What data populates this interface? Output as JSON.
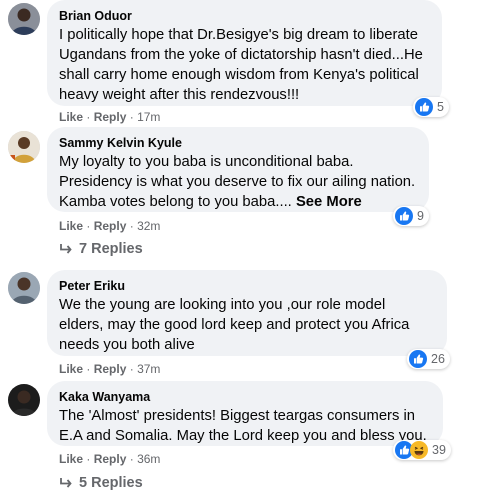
{
  "comments": [
    {
      "author": "Brian Oduor",
      "lines": [
        "I politically hope that Dr.Besigye's big dream to liberate",
        "Ugandans from the yoke of dictatorship hasn't died...He",
        "shall carry home enough wisdom from Kenya's political",
        "heavy weight after this rendezvous!!!"
      ],
      "like": "Like",
      "reply": "Reply",
      "time": "17m",
      "reaction_count": "5",
      "reactions": [
        "like-icon"
      ]
    },
    {
      "author": "Sammy Kelvin Kyule",
      "lines": [
        "My loyalty to you baba is unconditional baba.",
        "Presidency is what you deserve to fix our ailing nation.",
        "Kamba votes belong to you baba...."
      ],
      "see_more": "See More",
      "like": "Like",
      "reply": "Reply",
      "time": "32m",
      "reaction_count": "9",
      "reactions": [
        "like-icon"
      ],
      "replies_label": "7 Replies"
    },
    {
      "author": "Peter Eriku",
      "lines": [
        "We the young are looking into you ,our role model",
        "elders, may the good lord keep and protect you Africa",
        "needs you both alive"
      ],
      "like": "Like",
      "reply": "Reply",
      "time": "37m",
      "reaction_count": "26",
      "reactions": [
        "like-icon"
      ]
    },
    {
      "author": "Kaka Wanyama",
      "lines": [
        "The 'Almost' presidents! Biggest teargas consumers in",
        "E.A and Somalia. May the Lord keep you and bless you."
      ],
      "like": "Like",
      "reply": "Reply",
      "time": "36m",
      "reaction_count": "39",
      "reactions": [
        "like-icon",
        "haha-icon"
      ],
      "replies_label": "5 Replies"
    }
  ],
  "separator": "·",
  "colors": {
    "bubble": "#f0f2f5",
    "secondary_text": "#65676b",
    "like_blue": "#1877f2",
    "haha_yellow": "#f7b928"
  }
}
